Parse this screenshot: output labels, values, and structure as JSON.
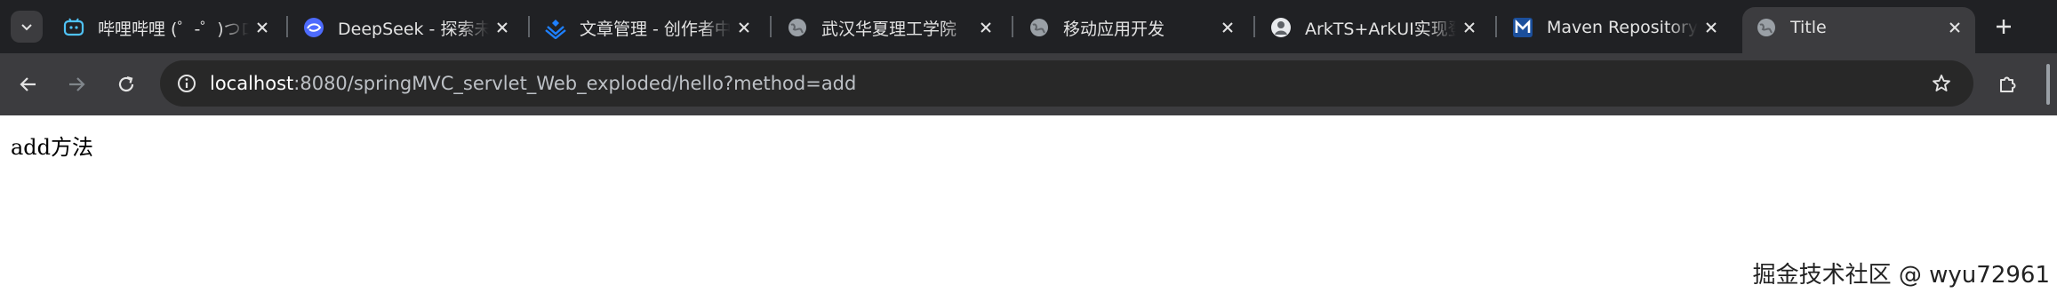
{
  "tabs": [
    {
      "title": "哔哩哔哩 (゜-゜)つロ 干杯~-bilibili",
      "favicon": "bilibili-icon",
      "active": false
    },
    {
      "title": "DeepSeek - 探索未至之境",
      "favicon": "deepseek-icon",
      "active": false
    },
    {
      "title": "文章管理 - 创作者中心",
      "favicon": "juejin-icon",
      "active": false
    },
    {
      "title": "武汉华夏理工学院",
      "favicon": "globe-icon",
      "active": false
    },
    {
      "title": "移动应用开发",
      "favicon": "globe-icon",
      "active": false
    },
    {
      "title": "ArkTS+ArkUI实现登录",
      "favicon": "avatar-icon",
      "active": false
    },
    {
      "title": "Maven Repository: Search",
      "favicon": "maven-icon",
      "active": false
    },
    {
      "title": "Title",
      "favicon": "globe-icon",
      "active": true
    }
  ],
  "address_bar": {
    "host": "localhost",
    "rest": ":8080/springMVC_servlet_Web_exploded/hello?method=add"
  },
  "page": {
    "body_text": "add方法"
  },
  "watermark": "掘金技术社区 @ wyu72961",
  "colors": {
    "tabstrip_bg": "#202124",
    "toolbar_bg": "#3c3c3f",
    "omnibox_bg": "#282828",
    "text_light": "#e3e3e3"
  }
}
